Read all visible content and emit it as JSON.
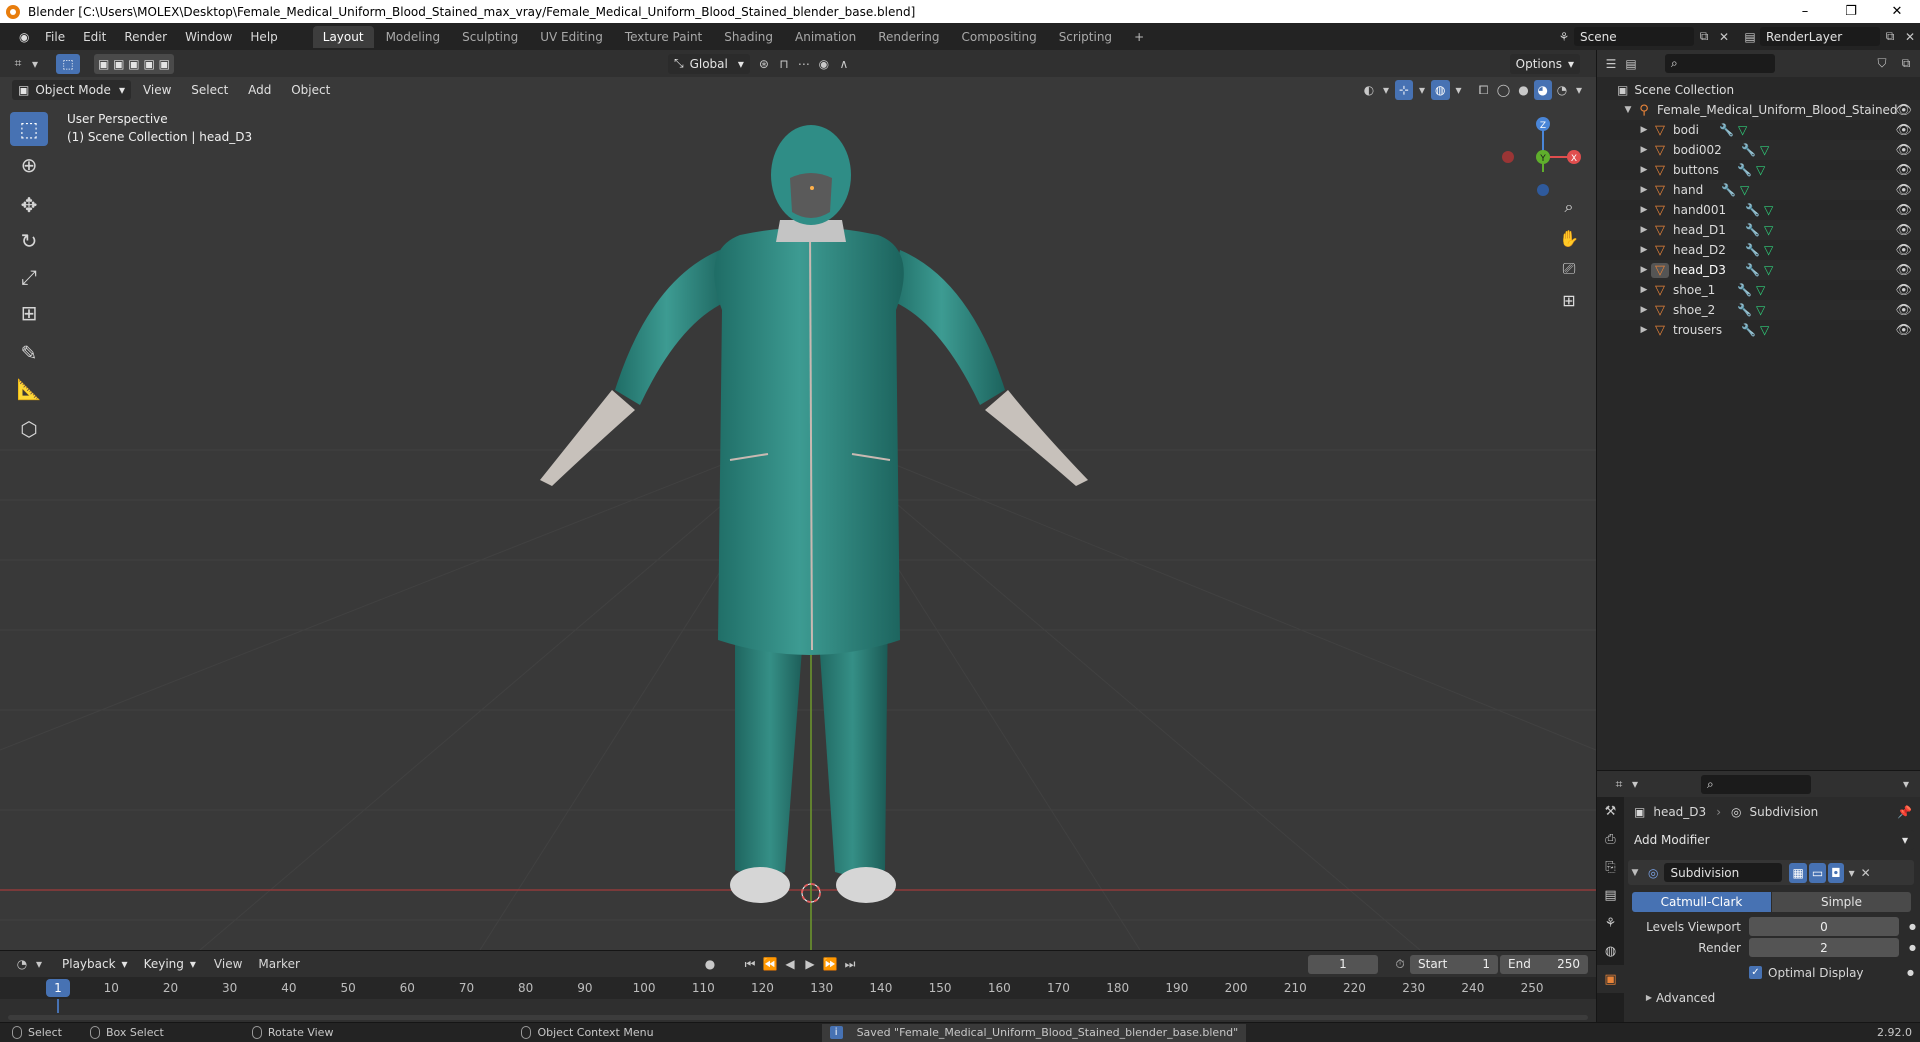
{
  "titlebar": {
    "title": "Blender [C:\\Users\\MOLEX\\Desktop\\Female_Medical_Uniform_Blood_Stained_max_vray/Female_Medical_Uniform_Blood_Stained_blender_base.blend]",
    "minimize": "–",
    "maximize": "❐",
    "close": "✕"
  },
  "menu": {
    "items": [
      "File",
      "Edit",
      "Render",
      "Window",
      "Help"
    ]
  },
  "workspaces": {
    "tabs": [
      "Layout",
      "Modeling",
      "Sculpting",
      "UV Editing",
      "Texture Paint",
      "Shading",
      "Animation",
      "Rendering",
      "Compositing",
      "Scripting"
    ],
    "active": "Layout",
    "add": "+"
  },
  "scene": {
    "name": "Scene",
    "render_layer": "RenderLayer"
  },
  "viewport": {
    "orientation": "Global",
    "options": "Options",
    "mode": "Object Mode",
    "menu": [
      "View",
      "Select",
      "Add",
      "Object"
    ],
    "perspective_label": "User Perspective",
    "collection_label": "(1) Scene Collection | head_D3"
  },
  "gizmo": {
    "x": "X",
    "y": "Y",
    "z": "Z"
  },
  "outliner": {
    "root": "Scene Collection",
    "collection": "Female_Medical_Uniform_Blood_Stained",
    "objects": [
      "bodi",
      "bodi002",
      "buttons",
      "hand",
      "hand001",
      "head_D1",
      "head_D2",
      "head_D3",
      "shoe_1",
      "shoe_2",
      "trousers"
    ]
  },
  "properties": {
    "object_name": "head_D3",
    "modifier_breadcrumb": "Subdivision",
    "add_modifier": "Add Modifier",
    "modifier_name": "Subdivision",
    "algo_catmull": "Catmull-Clark",
    "algo_simple": "Simple",
    "levels_viewport_label": "Levels Viewport",
    "levels_viewport_value": "0",
    "render_label": "Render",
    "render_value": "2",
    "optimal_display": "Optimal Display",
    "advanced": "Advanced"
  },
  "timeline": {
    "menu": [
      "Playback",
      "Keying",
      "View",
      "Marker"
    ],
    "current_frame": "1",
    "start_label": "Start",
    "start": "1",
    "end_label": "End",
    "end": "250",
    "ticks": [
      "10",
      "20",
      "30",
      "40",
      "50",
      "60",
      "70",
      "80",
      "90",
      "100",
      "110",
      "120",
      "130",
      "140",
      "150",
      "160",
      "170",
      "180",
      "190",
      "200",
      "210",
      "220",
      "230",
      "240",
      "250"
    ],
    "indicator": "1"
  },
  "statusbar": {
    "select": "Select",
    "box_select": "Box Select",
    "rotate_view": "Rotate View",
    "context_menu": "Object Context Menu",
    "message": "Saved \"Female_Medical_Uniform_Blood_Stained_blender_base.blend\"",
    "version": "2.92.0"
  },
  "colors": {
    "accent": "#4772b3",
    "object_icon": "#e8843a",
    "mesh_icon": "#2fd07b",
    "uniform": "#2f8f86"
  }
}
